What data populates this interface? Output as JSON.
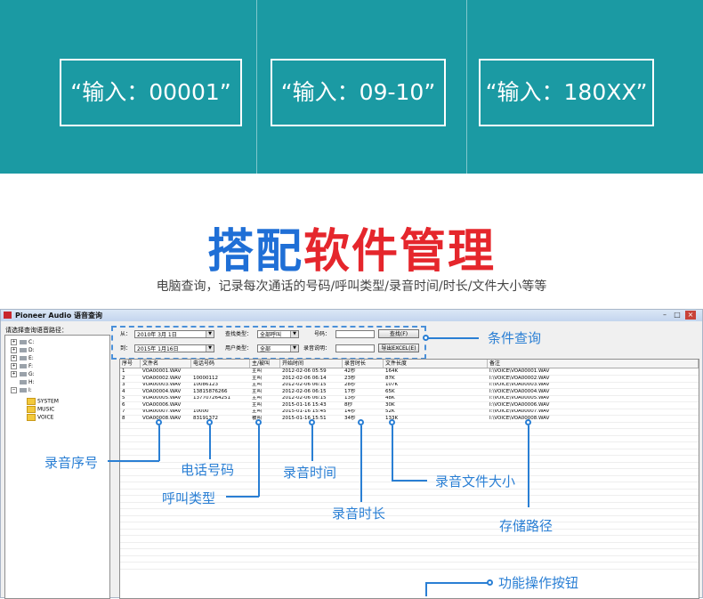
{
  "banner": {
    "box1": "“输入：00001”",
    "box2": "“输入：09-10”",
    "box3": "“输入：180XX”"
  },
  "heading": {
    "part1": "搭配",
    "part2": "软件管理"
  },
  "subtitle": "电脑查询，记录每次通话的号码/呼叫类型/录音时间/时长/文件大小等等",
  "window": {
    "title": "Pioneer Audio 语音查询",
    "tree_label": "请选择查询语音路径：",
    "drives": [
      "C:",
      "D:",
      "E:",
      "F:",
      "G:",
      "H:",
      "I:"
    ],
    "folders": [
      "SYSTEM",
      "MUSIC",
      "VOICE"
    ]
  },
  "query": {
    "from_label": "从：",
    "from_value": "2010年 3月 1日",
    "to_label": "到：",
    "to_value": "2015年 1月16日",
    "type_label": "查找类型：",
    "type_value": "全部呼叫",
    "user_type_label": "用户类型：",
    "user_type_value": "全部",
    "number_label": "号码：",
    "number_value": "",
    "desc_label": "录音说明：",
    "desc_value": "",
    "search_button": "查找(F)",
    "export_button": "导出EXCEL(E)"
  },
  "table": {
    "headers": [
      "序号",
      "文件名",
      "电话号码",
      "主/被叫",
      "开始时间",
      "录音时长",
      "文件长度",
      "备注"
    ],
    "rows": [
      [
        "1",
        "VOA00001.WAV",
        "",
        "主叫",
        "2012-02-06 05:59",
        "42秒",
        "164K",
        "I:\\VOICE\\VOA00001.WAV"
      ],
      [
        "2",
        "VOA00002.WAV",
        "10000112",
        "主叫",
        "2012-02-06 06:14",
        "23秒",
        "87K",
        "I:\\VOICE\\VOA00002.WAV"
      ],
      [
        "3",
        "VOA00003.WAV",
        "10086123",
        "主叫",
        "2012-02-06 06:15",
        "28秒",
        "107K",
        "I:\\VOICE\\VOA00003.WAV"
      ],
      [
        "4",
        "VOA00004.WAV",
        "13815876266",
        "主叫",
        "2012-02-06 06:15",
        "17秒",
        "65K",
        "I:\\VOICE\\VOA00004.WAV"
      ],
      [
        "5",
        "VOA00005.WAV",
        "137707264251",
        "主叫",
        "2012-02-06 06:15",
        "13秒",
        "48K",
        "I:\\VOICE\\VOA00005.WAV"
      ],
      [
        "6",
        "VOA00006.WAV",
        "",
        "主叫",
        "2015-01-16 15:43",
        "8秒",
        "30K",
        "I:\\VOICE\\VOA00006.WAV"
      ],
      [
        "7",
        "VOA00007.WAV",
        "10000",
        "主叫",
        "2015-01-16 15:45",
        "14秒",
        "52K",
        "I:\\VOICE\\VOA00007.WAV"
      ],
      [
        "8",
        "VOA00008.WAV",
        "83191372",
        "被叫",
        "2015-01-16 15:51",
        "34秒",
        "133K",
        "I:\\VOICE\\VOA00008.WAV"
      ]
    ]
  },
  "callouts": {
    "condition_query": "条件查询",
    "record_no": "录音序号",
    "phone_no": "电话号码",
    "call_type": "呼叫类型",
    "record_time": "录音时间",
    "record_duration": "录音时长",
    "file_size": "录音文件大小",
    "storage_path": "存储路径",
    "function_buttons": "功能操作按钮"
  },
  "colors": {
    "banner": "#1b9aa3",
    "accent_blue": "#1f6fd6",
    "accent_red": "#e5262c",
    "callout": "#2a7fd4"
  }
}
